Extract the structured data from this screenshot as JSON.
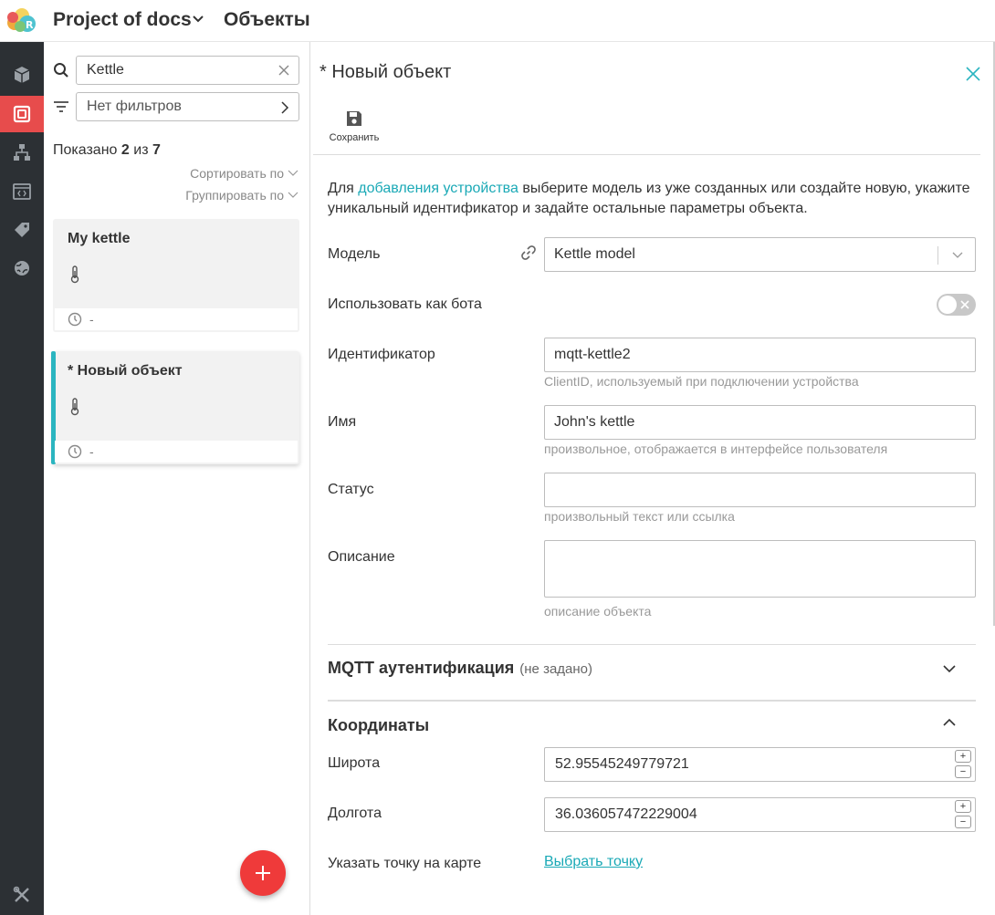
{
  "topbar": {
    "project_name": "Project of docs",
    "section_title": "Объекты"
  },
  "rail": {
    "items": [
      {
        "icon": "cube-icon",
        "active": false
      },
      {
        "icon": "objects-icon",
        "active": true
      },
      {
        "icon": "hierarchy-icon",
        "active": false
      },
      {
        "icon": "code-window-icon",
        "active": false
      },
      {
        "icon": "tag-icon",
        "active": false
      },
      {
        "icon": "globe-icon",
        "active": false
      },
      {
        "icon": "tools-icon",
        "active": false
      }
    ]
  },
  "list": {
    "search_value": "Kettle",
    "filter_label": "Нет фильтров",
    "shown_prefix": "Показано",
    "shown_count": "2",
    "shown_mid": "из",
    "shown_total": "7",
    "sort_label": "Сортировать по",
    "group_label": "Группировать по",
    "cards": [
      {
        "title": "My kettle",
        "footer": "-"
      },
      {
        "title": "* Новый объект",
        "footer": "-"
      }
    ]
  },
  "form": {
    "title": "* Новый объект",
    "save_label": "Сохранить",
    "intro_before": "Для ",
    "intro_link": "добавления устройства",
    "intro_after": " выберите модель из уже созданных или создайте новую, укажите уникальный идентификатор и задайте остальные параметры объекта.",
    "model_label": "Модель",
    "model_value": "Kettle model",
    "bot_label": "Использовать как бота",
    "id_label": "Идентификатор",
    "id_value": "mqtt-kettle2",
    "id_hint": "ClientID, используемый при подключении устройства",
    "name_label": "Имя",
    "name_value": "John's kettle",
    "name_hint": "произвольное, отображается в интерфейсе пользователя",
    "status_label": "Статус",
    "status_value": "",
    "status_hint": "произвольный текст или ссылка",
    "desc_label": "Описание",
    "desc_value": "",
    "desc_hint": "описание объекта",
    "mqtt_title": "MQTT аутентификация",
    "mqtt_sub": "(не задано)",
    "coords_title": "Координаты",
    "lat_label": "Широта",
    "lat_value": "52.95545249779721",
    "lon_label": "Долгота",
    "lon_value": "36.036057472229004",
    "map_label": "Указать точку на карте",
    "map_link": "Выбрать точку"
  },
  "colors": {
    "accent": "#1aa9b6",
    "active_rail": "#e74c4c",
    "fab": "#ef3a3a",
    "rail_bg": "#2c3034"
  }
}
